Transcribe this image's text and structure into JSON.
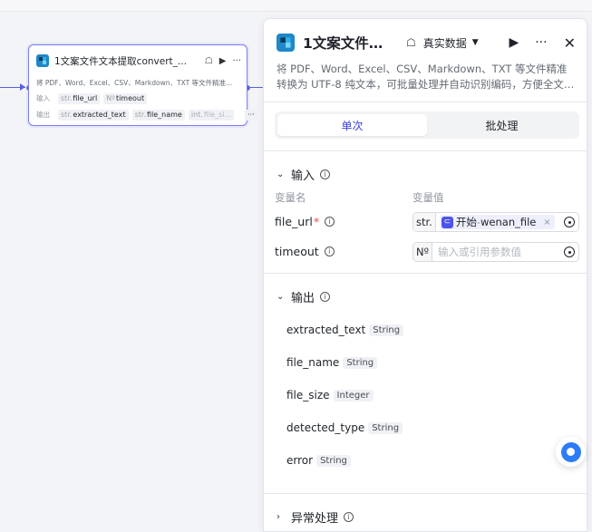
{
  "node": {
    "title": "1文案文件文本提取convert_...",
    "desc": "将 PDF、Word、Excel、CSV、Markdown、TXT 等文件精准...",
    "input_label": "输入",
    "output_label": "输出",
    "inputs": [
      {
        "type": "str.",
        "name": "file_url"
      },
      {
        "type": "Nº",
        "name": "timeout"
      }
    ],
    "outputs": [
      {
        "type": "str.",
        "name": "extracted_text"
      },
      {
        "type": "str.",
        "name": "file_name"
      },
      {
        "type": "int.",
        "name": "file_si..."
      }
    ],
    "more": "···"
  },
  "panel": {
    "title": "1文案文件…",
    "mode": "真实数据",
    "desc": "将 PDF、Word、Excel、CSV、Markdown、TXT 等文件精准转换为 UTF-8 纯文本，可批量处理并自动识别编码，方便全文…",
    "tabs": [
      "单次",
      "批处理"
    ],
    "input_section": "输入",
    "col_name": "变量名",
    "col_value": "变量值",
    "params": [
      {
        "name": "file_url",
        "required": "*",
        "type": "str.",
        "ref_node": "开始",
        "ref_sep": " - ",
        "ref_var": "wenan_file",
        "ref_close": "×"
      },
      {
        "name": "timeout",
        "type": "Nº",
        "placeholder": "输入或引用参数值"
      }
    ],
    "output_section": "输出",
    "outputs": [
      {
        "name": "extracted_text",
        "type": "String"
      },
      {
        "name": "file_name",
        "type": "String"
      },
      {
        "name": "file_size",
        "type": "Integer"
      },
      {
        "name": "detected_type",
        "type": "String"
      },
      {
        "name": "error",
        "type": "String"
      }
    ],
    "exception_section": "异常处理"
  },
  "colors": {
    "accent": "#3b42d9",
    "edge": "#5b5fe0",
    "brand_icon": "#1e88c8"
  }
}
